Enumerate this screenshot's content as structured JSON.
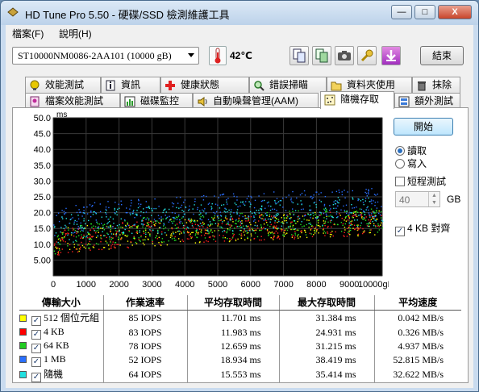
{
  "window": {
    "title": "HD Tune Pro 5.50 - 硬碟/SSD 檢測維護工具",
    "controls": {
      "minimize": "—",
      "maximize": "□",
      "close": "X"
    }
  },
  "menu": [
    {
      "label": "檔案(F)",
      "name": "menu-file"
    },
    {
      "label": "說明(H)",
      "name": "menu-help"
    }
  ],
  "toolbar": {
    "drive": "ST10000NM0086-2AA101 (10000 gB)",
    "temperature": "42℃",
    "exit_label": "結束"
  },
  "tabs_row1": [
    {
      "label": "效能測試",
      "icon": "benchmark-icon"
    },
    {
      "label": "資訊",
      "icon": "info-icon"
    },
    {
      "label": "健康狀態",
      "icon": "health-cross-icon"
    },
    {
      "label": "錯誤掃瞄",
      "icon": "magnifier-icon"
    },
    {
      "label": "資料夾使用",
      "icon": "folder-icon"
    },
    {
      "label": "抹除",
      "icon": "trash-icon"
    }
  ],
  "tabs_row2": [
    {
      "label": "檔案效能測試",
      "icon": "file-benchmark-icon"
    },
    {
      "label": "磁碟監控",
      "icon": "monitor-chart-icon"
    },
    {
      "label": "自動噪聲管理(AAM)",
      "icon": "speaker-icon"
    },
    {
      "label": "隨機存取",
      "icon": "random-access-icon",
      "active": true
    },
    {
      "label": "額外測試",
      "icon": "extra-tests-icon"
    }
  ],
  "side": {
    "start_label": "開始",
    "read_label": "讀取",
    "write_label": "寫入",
    "short_test_label": "短程測試",
    "short_test_value": "40",
    "gb_label": "GB",
    "align_label": "4 KB 對齊",
    "mode": "read",
    "short_test_checked": false,
    "align_checked": true
  },
  "chart_data": {
    "type": "scatter",
    "ylabel": "ms",
    "xunit": "gB",
    "ylim": [
      0,
      50
    ],
    "xlim": [
      0,
      10000
    ],
    "yticks": [
      "50.0",
      "45.0",
      "40.0",
      "35.0",
      "30.0",
      "25.0",
      "20.0",
      "15.0",
      "10.0",
      "5.00"
    ],
    "xticks": [
      "0",
      "1000",
      "2000",
      "3000",
      "4000",
      "5000",
      "6000",
      "7000",
      "8000",
      "9000",
      "10000gB"
    ],
    "grid": true,
    "background": "#000000",
    "series": [
      {
        "name": "512 個位元組",
        "color": "#ffff00",
        "min_ms": [
          5.5,
          13.0
        ],
        "max_ms": [
          14.0,
          21.0
        ]
      },
      {
        "name": "4 KB",
        "color": "#ff2020",
        "min_ms": [
          5.5,
          13.0
        ],
        "max_ms": [
          14.0,
          21.0
        ]
      },
      {
        "name": "64 KB",
        "color": "#22dd22",
        "min_ms": [
          6.5,
          14.0
        ],
        "max_ms": [
          15.5,
          22.0
        ]
      },
      {
        "name": "1 MB",
        "color": "#2a6fff",
        "min_ms": [
          12.0,
          19.0
        ],
        "max_ms": [
          21.0,
          28.0
        ]
      },
      {
        "name": "隨機",
        "color": "#22e0e0",
        "min_ms": [
          9.0,
          16.0
        ],
        "max_ms": [
          18.5,
          25.5
        ]
      }
    ]
  },
  "results": {
    "headers": [
      "傳輸大小",
      "作業速率",
      "平均存取時間",
      "最大存取時間",
      "平均速度"
    ],
    "rows": [
      {
        "color": "#ffff00",
        "label": "512 個位元組",
        "iops": "85 IOPS",
        "avg": "11.701 ms",
        "max": "31.384 ms",
        "speed": "0.042 MB/s"
      },
      {
        "color": "#ff0000",
        "label": "4 KB",
        "iops": "83 IOPS",
        "avg": "11.983 ms",
        "max": "24.931 ms",
        "speed": "0.326 MB/s"
      },
      {
        "color": "#22cc22",
        "label": "64 KB",
        "iops": "78 IOPS",
        "avg": "12.659 ms",
        "max": "31.215 ms",
        "speed": "4.937 MB/s"
      },
      {
        "color": "#2a6fff",
        "label": "1 MB",
        "iops": "52 IOPS",
        "avg": "18.934 ms",
        "max": "38.419 ms",
        "speed": "52.815 MB/s"
      },
      {
        "color": "#22e0e0",
        "label": "隨機",
        "iops": "64 IOPS",
        "avg": "15.553 ms",
        "max": "35.414 ms",
        "speed": "32.622 MB/s"
      }
    ]
  }
}
